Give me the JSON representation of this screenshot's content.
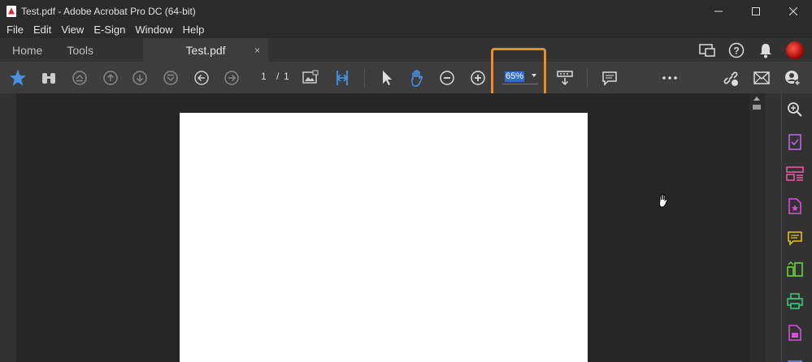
{
  "window": {
    "title": "Test.pdf - Adobe Acrobat Pro DC (64-bit)",
    "controls": [
      "minimize",
      "maximize",
      "close"
    ]
  },
  "menu": [
    "File",
    "Edit",
    "View",
    "E-Sign",
    "Window",
    "Help"
  ],
  "tabs": {
    "home": "Home",
    "tools": "Tools",
    "document": "Test.pdf",
    "close": "×"
  },
  "toolbar": {
    "page_current": "1",
    "page_separator": "/",
    "page_total": "1",
    "zoom": "65%"
  },
  "colors": {
    "highlight": "#f08c1e",
    "accent_blue": "#4a90e2"
  },
  "icons": {
    "toolbar": [
      "star-bookmark-icon",
      "find-icon",
      "first-page-icon",
      "previous-page-icon",
      "next-page-icon",
      "last-page-icon",
      "back-icon",
      "forward-icon",
      "scan-image-icon",
      "page-layout-icon",
      "select-cursor-icon",
      "hand-tool-icon",
      "zoom-out-icon",
      "zoom-in-icon",
      "read-mode-icon",
      "comment-icon",
      "more-icon",
      "share-link-icon",
      "email-icon",
      "add-user-icon"
    ],
    "right_pane": [
      "search-zoom-icon",
      "fill-sign-icon",
      "organize-pages-icon",
      "export-pdf-icon",
      "comment-icon",
      "compare-icon",
      "print-production-icon",
      "protect-icon"
    ]
  }
}
